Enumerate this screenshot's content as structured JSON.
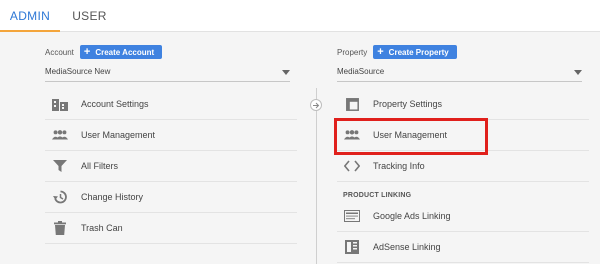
{
  "tabs": {
    "admin": "ADMIN",
    "user": "USER"
  },
  "account": {
    "label": "Account",
    "create_label": "Create Account",
    "selected": "MediaSource New",
    "items": [
      {
        "label": "Account Settings",
        "icon": "building-icon"
      },
      {
        "label": "User Management",
        "icon": "users-icon"
      },
      {
        "label": "All Filters",
        "icon": "filter-icon"
      },
      {
        "label": "Change History",
        "icon": "history-icon"
      },
      {
        "label": "Trash Can",
        "icon": "trash-icon"
      }
    ]
  },
  "property": {
    "label": "Property",
    "create_label": "Create Property",
    "selected": "MediaSource",
    "items": [
      {
        "label": "Property Settings",
        "icon": "property-settings-icon"
      },
      {
        "label": "User Management",
        "icon": "users-icon"
      },
      {
        "label": "Tracking Info",
        "icon": "code-icon"
      }
    ],
    "linking_section": "PRODUCT LINKING",
    "linking_items": [
      {
        "label": "Google Ads Linking",
        "icon": "ads-icon"
      },
      {
        "label": "AdSense Linking",
        "icon": "adsense-icon"
      }
    ]
  },
  "colors": {
    "accent_blue": "#3f82e0",
    "tab_indicator": "#f4a53b",
    "highlight_red": "#e0201c"
  }
}
